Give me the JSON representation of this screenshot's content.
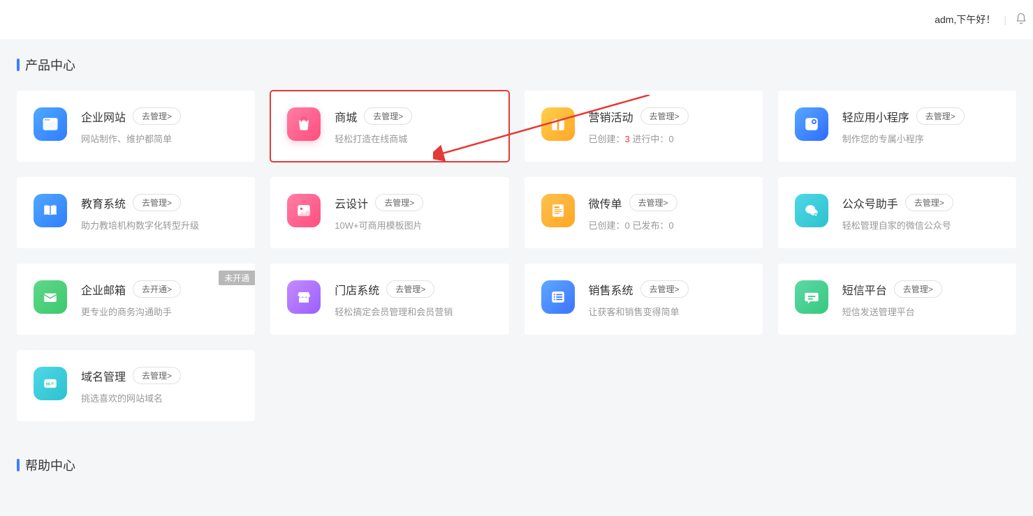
{
  "header": {
    "greeting": "adm,下午好！"
  },
  "sections": {
    "products_title": "产品中心",
    "help_title": "帮助中心"
  },
  "cards": [
    {
      "title": "企业网站",
      "button": "去管理>",
      "desc": "网站制作、维护都简单"
    },
    {
      "title": "商城",
      "button": "去管理>",
      "desc": "轻松打造在线商城"
    },
    {
      "title": "营销活动",
      "button": "去管理>",
      "desc_prefix": "已创建：",
      "count1": "3",
      "desc_mid": "   进行中：",
      "count2": "0"
    },
    {
      "title": "轻应用小程序",
      "button": "去管理>",
      "desc": "制作您的专属小程序"
    },
    {
      "title": "教育系统",
      "button": "去管理>",
      "desc": "助力教培机构数字化转型升级"
    },
    {
      "title": "云设计",
      "button": "去管理>",
      "desc": "10W+可商用模板图片"
    },
    {
      "title": "微传单",
      "button": "去管理>",
      "desc_prefix": "已创建：",
      "count1": "0",
      "desc_mid": "   已发布：",
      "count2": "0"
    },
    {
      "title": "公众号助手",
      "button": "去管理>",
      "desc": "轻松管理自家的微信公众号"
    },
    {
      "title": "企业邮箱",
      "button": "去开通>",
      "desc": "更专业的商务沟通助手",
      "badge": "未开通"
    },
    {
      "title": "门店系统",
      "button": "去管理>",
      "desc": "轻松搞定会员管理和会员营销"
    },
    {
      "title": "销售系统",
      "button": "去管理>",
      "desc": "让获客和销售变得简单"
    },
    {
      "title": "短信平台",
      "button": "去管理>",
      "desc": "短信发送管理平台"
    },
    {
      "title": "域名管理",
      "button": "去管理>",
      "desc": "挑选喜欢的网站域名"
    }
  ]
}
